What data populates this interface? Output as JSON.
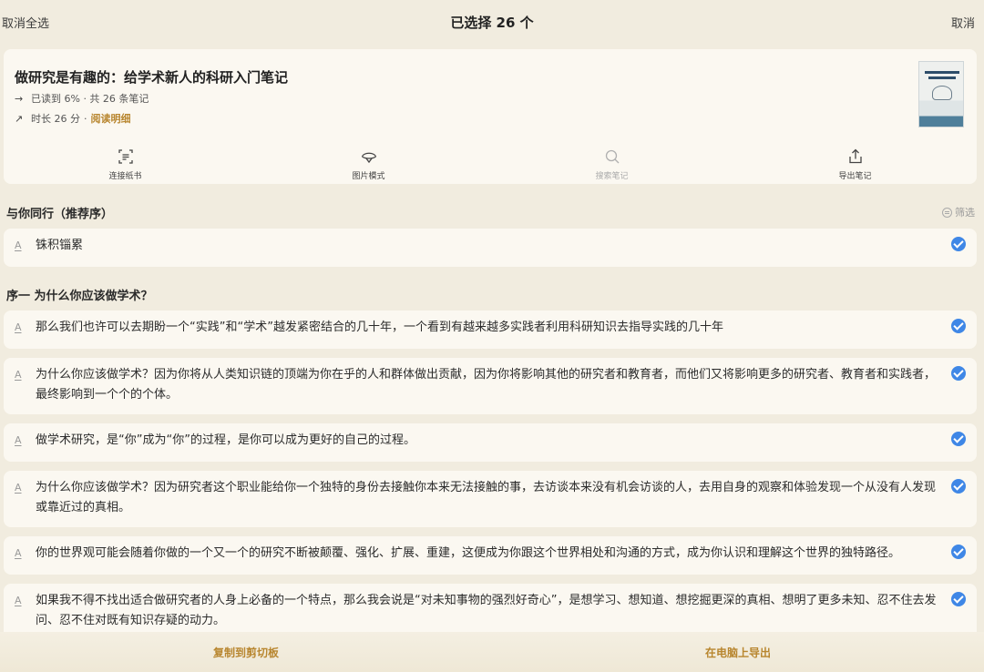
{
  "topbar": {
    "deselect_all": "取消全选",
    "title": "已选择 26 个",
    "cancel": "取消"
  },
  "book": {
    "title": "做研究是有趣的：给学术新人的科研入门笔记",
    "progress_text": "已读到 6% · 共 26 条笔记",
    "duration_text": "时长 26 分",
    "dot": "·",
    "detail_link": "阅读明细",
    "cover_icon": "book-cover"
  },
  "actions": [
    {
      "label": "连接纸书",
      "icon": "scan-text-icon"
    },
    {
      "label": "图片模式",
      "icon": "image-mode-icon"
    },
    {
      "label": "搜索笔记",
      "icon": "search-icon"
    },
    {
      "label": "导出笔记",
      "icon": "share-export-icon"
    }
  ],
  "sections": {
    "s1_title": "与你同行（推荐序）",
    "filter_label": "筛选",
    "s2_title": "序一 为什么你应该做学术？"
  },
  "notes": [
    {
      "text": "铢积锱累"
    },
    {
      "text": "那么我们也许可以去期盼一个“实践”和“学术”越发紧密结合的几十年，一个看到有越来越多实践者利用科研知识去指导实践的几十年"
    },
    {
      "text": "为什么你应该做学术？因为你将从人类知识链的顶端为你在乎的人和群体做出贡献，因为你将影响其他的研究者和教育者，而他们又将影响更多的研究者、教育者和实践者，最终影响到一个个的个体。"
    },
    {
      "text": "做学术研究，是“你”成为“你”的过程，是你可以成为更好的自己的过程。"
    },
    {
      "text": "为什么你应该做学术？因为研究者这个职业能给你一个独特的身份去接触你本来无法接触的事，去访谈本来没有机会访谈的人，去用自身的观察和体验发现一个从没有人发现或靠近过的真相。"
    },
    {
      "text": "你的世界观可能会随着你做的一个又一个的研究不断被颠覆、强化、扩展、重建，这便成为你跟这个世界相处和沟通的方式，成为你认识和理解这个世界的独特路径。"
    },
    {
      "text": "如果我不得不找出适合做研究者的人身上必备的一个特点，那么我会说是“对未知事物的强烈好奇心”，是想学习、想知道、想挖掘更深的真相、想明了更多未知、忍不住去发问、忍不住对既有知识存疑的动力。"
    }
  ],
  "note_mark": "A",
  "bottom": {
    "copy": "复制到剪切板",
    "export_pc": "在电脑上导出"
  },
  "colors": {
    "background": "#f1ecdf",
    "card": "#fbf8f1",
    "accent": "#b8862f",
    "check": "#3f87e6"
  }
}
